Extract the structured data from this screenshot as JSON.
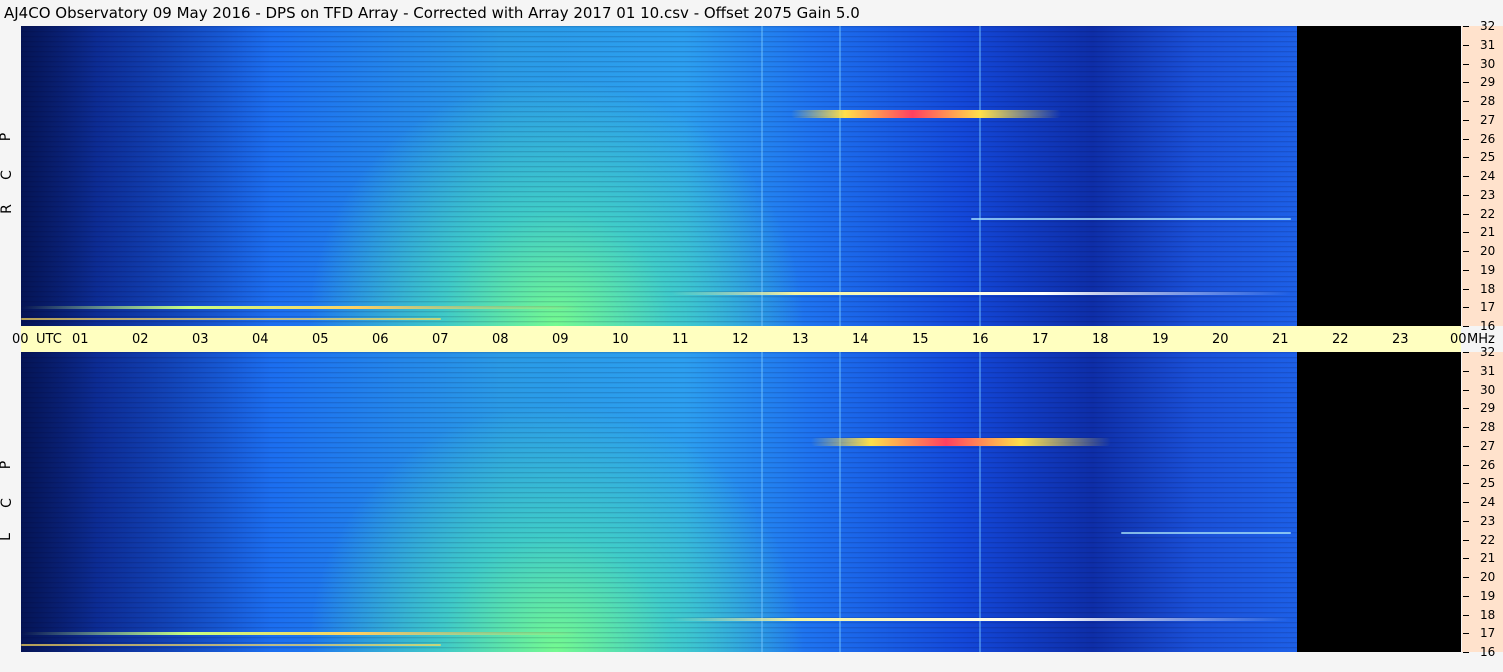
{
  "title": "AJ4CO Observatory  09 May 2016  -  DPS on TFD Array  -  Corrected with Array 2017 01 10.csv  -  Offset 2075  Gain 5.0",
  "panels": [
    {
      "label": [
        "R",
        "C",
        "P"
      ]
    },
    {
      "label": [
        "L",
        "C",
        "P"
      ]
    }
  ],
  "time_axis": {
    "ticks": [
      "00",
      "01",
      "02",
      "03",
      "04",
      "05",
      "06",
      "07",
      "08",
      "09",
      "10",
      "11",
      "12",
      "13",
      "14",
      "15",
      "16",
      "17",
      "18",
      "19",
      "20",
      "21",
      "22",
      "23",
      "00"
    ],
    "unit_left": "UTC",
    "unit_right": "MHz"
  },
  "freq_axis": {
    "ticks": [
      "32",
      "31",
      "30",
      "29",
      "28",
      "27",
      "26",
      "25",
      "24",
      "23",
      "22",
      "21",
      "20",
      "19",
      "18",
      "17",
      "16"
    ]
  },
  "chart_data": [
    {
      "type": "heatmap",
      "series": "R C P",
      "x_unit": "UTC",
      "y_unit": "MHz",
      "xlim": [
        0,
        24
      ],
      "ylim": [
        16,
        32
      ],
      "data_end_utc": 21.3,
      "peak_features": [
        {
          "utc": [
            12.9,
            15.4
          ],
          "mhz": 27.3,
          "level": "high"
        },
        {
          "utc": [
            10.8,
            21.2
          ],
          "mhz": 17.6,
          "level": "medium"
        }
      ],
      "colors": {
        "low": "#0b2c8c",
        "mid": "#2a9be6",
        "high": "#7dff8f",
        "peak": "#ff4060",
        "no_data": "#000000"
      }
    },
    {
      "type": "heatmap",
      "series": "L C P",
      "x_unit": "UTC",
      "y_unit": "MHz",
      "xlim": [
        0,
        24
      ],
      "ylim": [
        16,
        32
      ],
      "data_end_utc": 21.3,
      "peak_features": [
        {
          "utc": [
            13.2,
            15.9
          ],
          "mhz": 27.2,
          "level": "high"
        },
        {
          "utc": [
            10.8,
            21.2
          ],
          "mhz": 17.5,
          "level": "medium"
        }
      ],
      "colors": {
        "low": "#0b2c8c",
        "mid": "#2a9be6",
        "high": "#7dff8f",
        "peak": "#ff4060",
        "no_data": "#000000"
      }
    }
  ]
}
